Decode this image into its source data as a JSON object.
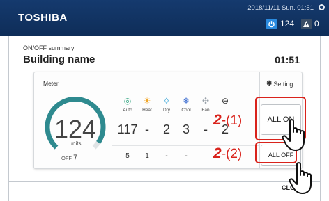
{
  "header": {
    "brand": "TOSHIBA",
    "datetime": "2018/11/11 Sun. 01:51",
    "on_count": "124",
    "alarm_count": "0"
  },
  "panel": {
    "summary_label": "ON/OFF summary",
    "building_name": "Building name",
    "time": "01:51"
  },
  "meter": {
    "title": "Meter",
    "value": "124",
    "units": "units",
    "off_label": "OFF",
    "off_value": "7",
    "gauge_fraction": 0.95
  },
  "modes": [
    {
      "icon": "auto-icon",
      "label": "Auto",
      "on": "117",
      "off": "5"
    },
    {
      "icon": "heat-icon",
      "label": "Heat",
      "on": "-",
      "off": "1"
    },
    {
      "icon": "dry-icon",
      "label": "Dry",
      "on": "2",
      "off": "-"
    },
    {
      "icon": "cool-icon",
      "label": "Cool",
      "on": "3",
      "off": "-"
    },
    {
      "icon": "fan-icon",
      "label": "Fan",
      "on": "-",
      "off": ""
    },
    {
      "icon": "other-icon",
      "label": "",
      "on": "2",
      "off": ""
    }
  ],
  "setting_label": "Setting",
  "buttons": {
    "all_on": "ALL ON",
    "all_off": "ALL OFF"
  },
  "callouts": {
    "on_num": "2",
    "on_step": "-(1)",
    "off_num": "2",
    "off_step": "-(2)"
  },
  "footer": {
    "close": "CLO"
  },
  "colors": {
    "header": "#153a6e",
    "gauge": "#2e8a8f",
    "accent_red": "#d9231c",
    "power_blue": "#2a8be0"
  }
}
